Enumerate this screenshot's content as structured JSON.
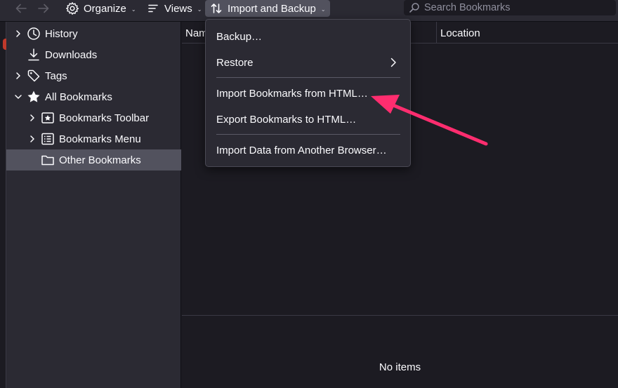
{
  "toolbar": {
    "back_icon": "arrow-left-icon",
    "forward_icon": "arrow-right-icon",
    "organize_label": "Organize",
    "views_label": "Views",
    "import_backup_label": "Import and Backup",
    "search_placeholder": "Search Bookmarks"
  },
  "sidebar": {
    "items": [
      {
        "label": "History",
        "icon": "clock-icon",
        "expandable": true
      },
      {
        "label": "Downloads",
        "icon": "download-icon",
        "expandable": false
      },
      {
        "label": "Tags",
        "icon": "tag-icon",
        "expandable": true
      },
      {
        "label": "All Bookmarks",
        "icon": "star-icon",
        "expandable": true,
        "expanded": true
      },
      {
        "label": "Bookmarks Toolbar",
        "icon": "bookmarks-toolbar-icon",
        "expandable": true
      },
      {
        "label": "Bookmarks Menu",
        "icon": "bookmarks-menu-icon",
        "expandable": true
      },
      {
        "label": "Other Bookmarks",
        "icon": "folder-icon",
        "expandable": false,
        "selected": true
      }
    ]
  },
  "table": {
    "columns": [
      "Name",
      "Location"
    ],
    "empty_text": "No items"
  },
  "menu": {
    "items": [
      {
        "label": "Backup…",
        "has_submenu": false
      },
      {
        "label": "Restore",
        "has_submenu": true
      },
      {
        "label": "Import Bookmarks from HTML…",
        "has_submenu": false
      },
      {
        "label": "Export Bookmarks to HTML…",
        "has_submenu": false
      },
      {
        "label": "Import Data from Another Browser…",
        "has_submenu": false
      }
    ]
  },
  "colors": {
    "background": "#1c1b22",
    "panel": "#2b2a33",
    "selected": "#52525e",
    "annotation_arrow": "#ff2d6f"
  }
}
